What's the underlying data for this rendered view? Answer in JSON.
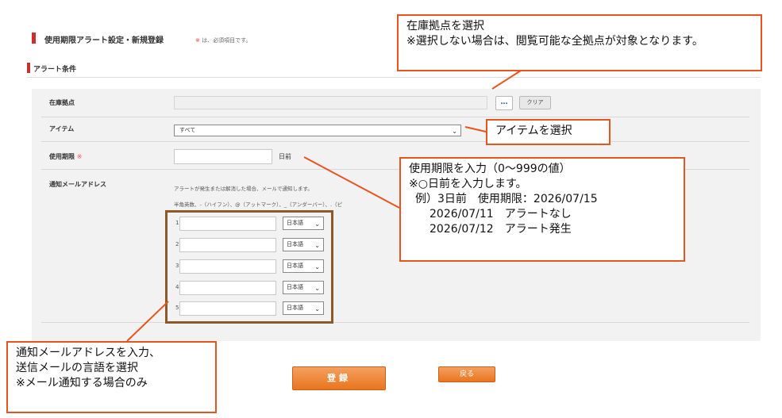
{
  "header": {
    "title": "使用期限アラート設定・新規登録",
    "required_mark": "※",
    "required_note": "は、必須項目です。"
  },
  "section": {
    "title": "アラート条件"
  },
  "form": {
    "location": {
      "label": "在庫拠点",
      "value": "",
      "browse_label": "…",
      "clear_label": "クリア"
    },
    "item": {
      "label": "アイテム",
      "selected": "すべて"
    },
    "expiry": {
      "label": "使用期限",
      "required_mark": "※",
      "value": "",
      "suffix": "日前"
    },
    "email": {
      "label": "通知メールアドレス",
      "hint1": "アラートが発生または解消した場合、メールで通知します。",
      "hint2": "半角英数、-（ハイフン）、@（アットマーク）、_（アンダーバー）、.（ピ",
      "rows": [
        {
          "num": "1",
          "value": "",
          "lang": "日本語"
        },
        {
          "num": "2",
          "value": "",
          "lang": "日本語"
        },
        {
          "num": "3",
          "value": "",
          "lang": "日本語"
        },
        {
          "num": "4",
          "value": "",
          "lang": "日本語"
        },
        {
          "num": "5",
          "value": "",
          "lang": "日本語"
        }
      ]
    }
  },
  "buttons": {
    "submit": "登録",
    "back": "戻る"
  },
  "callouts": {
    "location": [
      "在庫拠点を選択",
      "※選択しない場合は、閲覧可能な全拠点が対象となります。"
    ],
    "item": [
      "アイテムを選択"
    ],
    "expiry": [
      "使用期限を入力（0～999の値）",
      "※○日前を入力します。",
      "例）3日前　使用期限：2026/07/15",
      "2026/07/11　アラートなし",
      "2026/07/12　アラート発生"
    ],
    "email": [
      "通知メールアドレスを入力、",
      "送信メールの言語を選択",
      "※メール通知する場合のみ"
    ]
  },
  "colors": {
    "accent_red": "#c9302c",
    "callout_border": "#e9541f",
    "button_orange": "#e8751e",
    "email_highlight": "#8b5a2b"
  }
}
